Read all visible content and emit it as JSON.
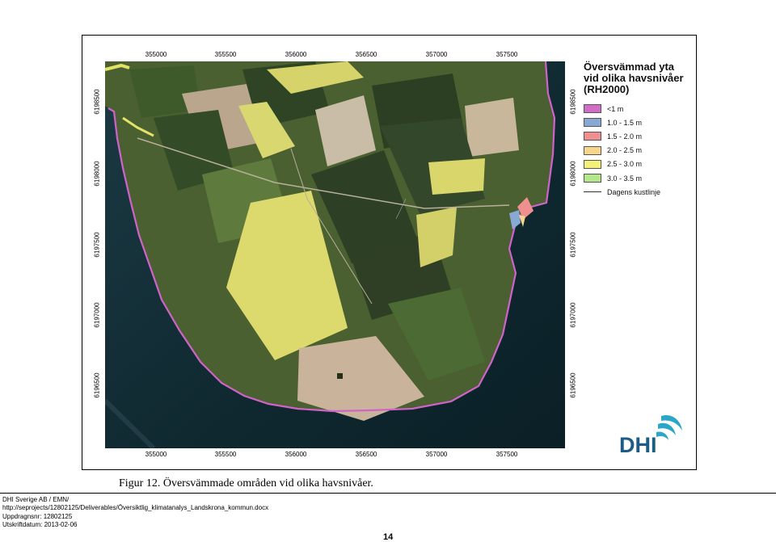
{
  "map": {
    "x_ticks": [
      "355000",
      "355500",
      "356000",
      "356500",
      "357000",
      "357500"
    ],
    "y_ticks": [
      "6198500",
      "6198000",
      "6197500",
      "6197000",
      "6196500"
    ]
  },
  "legend": {
    "title_lines": [
      "Översvämmad yta",
      "vid olika havsnivåer",
      "(RH2000)"
    ],
    "items": [
      {
        "label": "<1 m",
        "color": "#cf6ec4"
      },
      {
        "label": "1.0 - 1.5 m",
        "color": "#87a9d4"
      },
      {
        "label": "1.5 - 2.0 m",
        "color": "#f08f8f"
      },
      {
        "label": "2.0 - 2.5 m",
        "color": "#f7d58c"
      },
      {
        "label": "2.5 - 3.0 m",
        "color": "#f4f07a"
      },
      {
        "label": "3.0 - 3.5 m",
        "color": "#b4e68a"
      }
    ],
    "coastline_label": "Dagens kustlinje"
  },
  "logo": {
    "text": "DHI",
    "color": "#1d5c86",
    "accent": "#2aa6c8"
  },
  "caption": "Figur 12. Översvämmade områden vid olika havsnivåer.",
  "footer": {
    "lines": [
      "DHI Sverige AB / EMN/",
      "http://seprojects/12802125/Deliverables/Översiktlig_klimatanalys_Landskrona_kommun.docx",
      "Uppdragnsnr: 12802125",
      "Utskriftdatum: 2013-02-06"
    ],
    "page_number": "14"
  }
}
